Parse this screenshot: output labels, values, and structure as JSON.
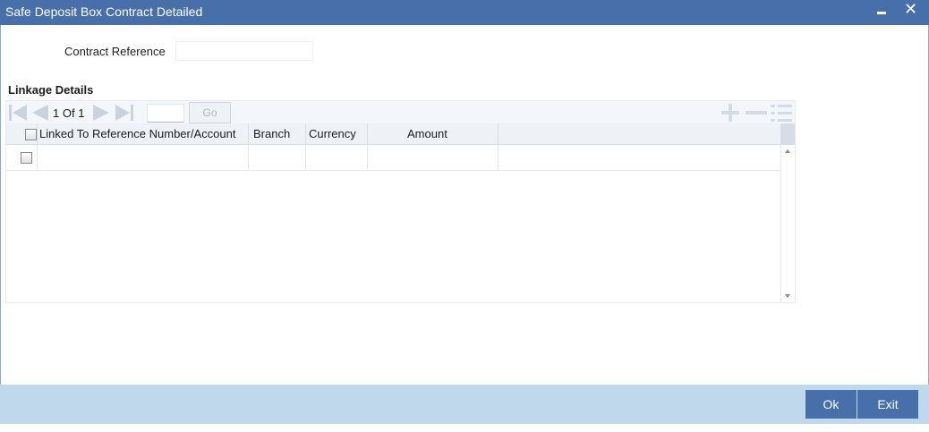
{
  "window": {
    "title": "Safe Deposit Box Contract Detailed"
  },
  "form": {
    "contract_reference_label": "Contract Reference",
    "contract_reference_value": ""
  },
  "linkage": {
    "section_title": "Linkage Details",
    "pagination": {
      "current": "1",
      "of_label": "Of",
      "total": "1",
      "go_label": "Go",
      "page_input_value": ""
    },
    "columns": [
      "Linked To Reference Number/Account",
      "Branch",
      "Currency",
      "Amount"
    ],
    "rows": [
      [
        "",
        "",
        "",
        ""
      ]
    ]
  },
  "footer": {
    "ok_label": "Ok",
    "exit_label": "Exit"
  },
  "colors": {
    "titlebar": "#476fa9",
    "footer": "#bfd8ec",
    "button": "#476fa9",
    "toolbar_icon": "#d3dbe6"
  },
  "icons": [
    "minimize-icon",
    "close-icon",
    "first-page-icon",
    "previous-page-icon",
    "next-page-icon",
    "last-page-icon",
    "add-row-icon",
    "delete-row-icon",
    "single-record-view-icon"
  ]
}
